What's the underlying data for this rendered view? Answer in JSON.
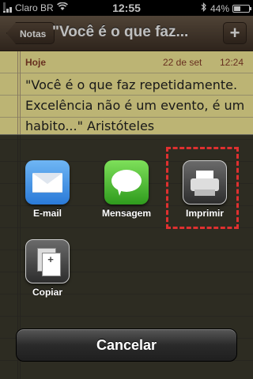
{
  "status_bar": {
    "carrier": "Claro BR",
    "time": "12:55",
    "battery": "44%",
    "battery_level": 0.44,
    "signal_bars": 3
  },
  "nav_bar": {
    "back_label": "Notas",
    "title": "\"Você é o que faz...",
    "add_label": "+"
  },
  "note": {
    "day_label": "Hoje",
    "date": "22 de set",
    "time": "12:24",
    "lines": [
      "\"Você é o que faz repetidamente.",
      "Excelência não é um evento, é um",
      "habito...\" Aristóteles"
    ]
  },
  "share_sheet": {
    "items": [
      {
        "label": "E-mail",
        "icon": "mail-icon"
      },
      {
        "label": "Mensagem",
        "icon": "message-icon"
      },
      {
        "label": "Imprimir",
        "icon": "printer-icon"
      },
      {
        "label": "Copiar",
        "icon": "copy-icon"
      }
    ],
    "cancel_label": "Cancelar",
    "highlight_color": "#e03030"
  }
}
